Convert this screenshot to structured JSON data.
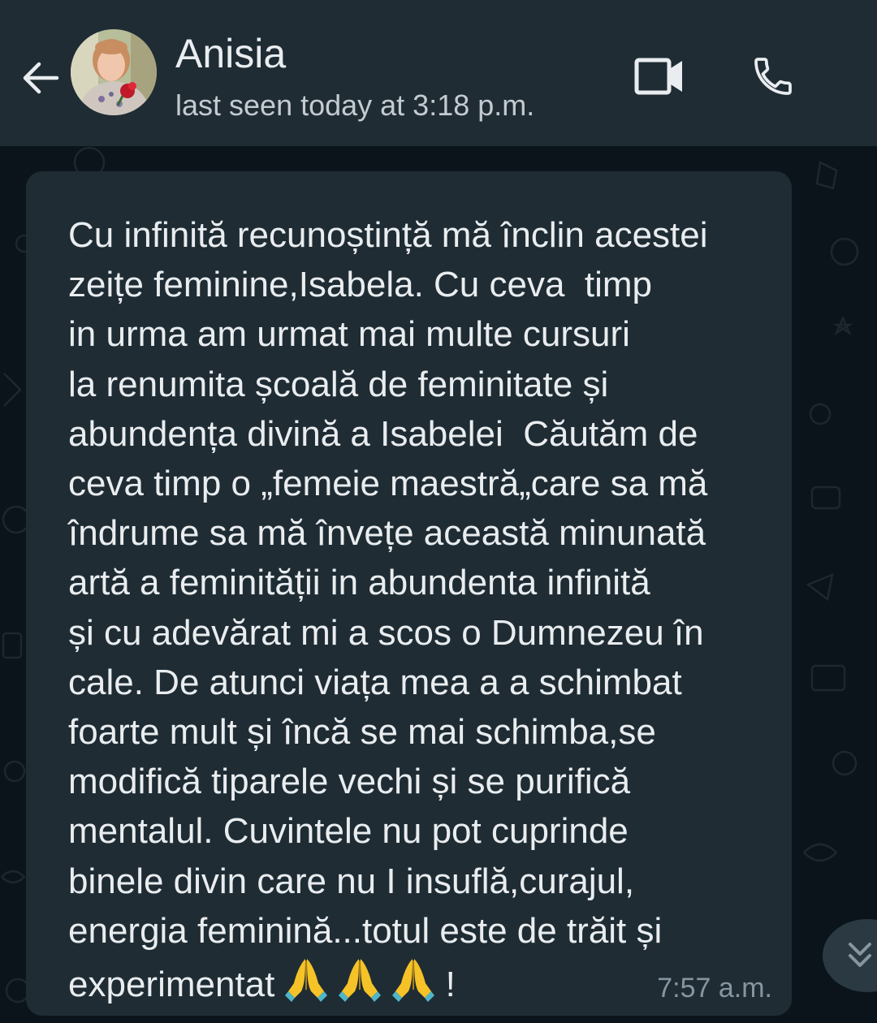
{
  "header": {
    "contact_name": "Anisia",
    "last_seen": "last seen today at 3:18 p.m.",
    "back_icon": "arrow-left-icon",
    "video_icon": "video-camera-icon",
    "call_icon": "phone-icon"
  },
  "message": {
    "lines": [
      "Cu infinită recunoștință mă înclin acestei",
      "zeițe feminine,Isabela. Cu ceva  timp",
      "in urma am urmat mai multe cursuri",
      "la renumita școală de feminitate și",
      "abundența divină a Isabelei  Căutăm de",
      "ceva timp o „femeie maestră„care sa mă",
      "îndrume sa mă învețe această minunată",
      "artă a feminității in abundenta infinită",
      "și cu adevărat mi a scos o Dumnezeu în",
      "cale. De atunci viața mea a a schimbat",
      "foarte mult și încă se mai schimba,se",
      "modifică tiparele vechi și se purifică",
      "mentalul. Cuvintele nu pot cuprinde",
      "binele divin care nu I insuflă,curajul,",
      "energia feminină...totul este de trăit și"
    ],
    "last_line_text": "experimentat",
    "last_line_end": "!",
    "emoji_name": "folded-hands-emoji",
    "emoji_count": 3,
    "time": "7:57 a.m."
  },
  "scroll_icon": "double-chevron-down-icon",
  "colors": {
    "header_bg": "#1f2c34",
    "chat_bg": "#0b141a",
    "bubble_bg": "#1f2c34",
    "text": "#e9edef",
    "secondary_text": "#8696a0"
  }
}
